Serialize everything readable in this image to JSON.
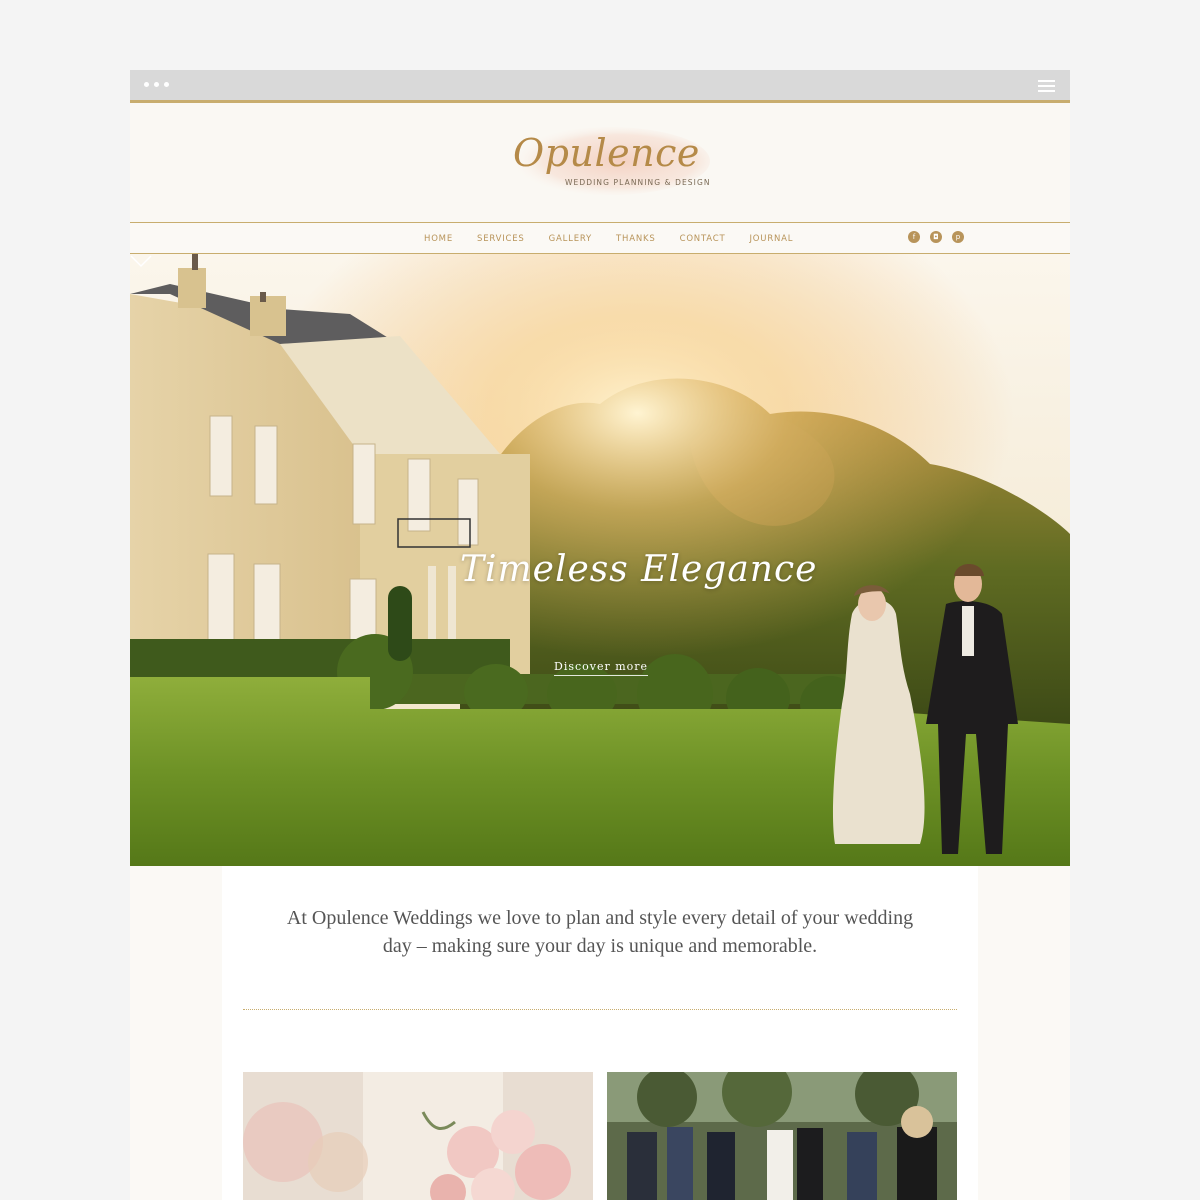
{
  "window": {
    "titlebar_color": "#d9d9d9",
    "accent_color": "#c8ad6e",
    "menu_icon": "hamburger-menu-icon"
  },
  "header": {
    "logo_script": "Opulence",
    "logo_tagline": "WEDDING PLANNING & DESIGN"
  },
  "nav": {
    "items": [
      "HOME",
      "SERVICES",
      "GALLERY",
      "THANKS",
      "CONTACT",
      "JOURNAL"
    ],
    "social": [
      {
        "icon": "facebook-icon",
        "glyph": "f"
      },
      {
        "icon": "instagram-icon",
        "glyph": "◘"
      },
      {
        "icon": "pinterest-icon",
        "glyph": "p"
      }
    ],
    "link_color": "#b8945a"
  },
  "hero": {
    "title": "Timeless Elegance",
    "cta": "Discover more",
    "scroll_icon": "chevron-down-icon"
  },
  "intro": {
    "text": "At Opulence Weddings we love to plan and style every detail of your wedding day – making sure your day is unique and memorable."
  },
  "cards": [
    {
      "name": "bouquet-photo"
    },
    {
      "name": "ceremony-photo"
    }
  ]
}
